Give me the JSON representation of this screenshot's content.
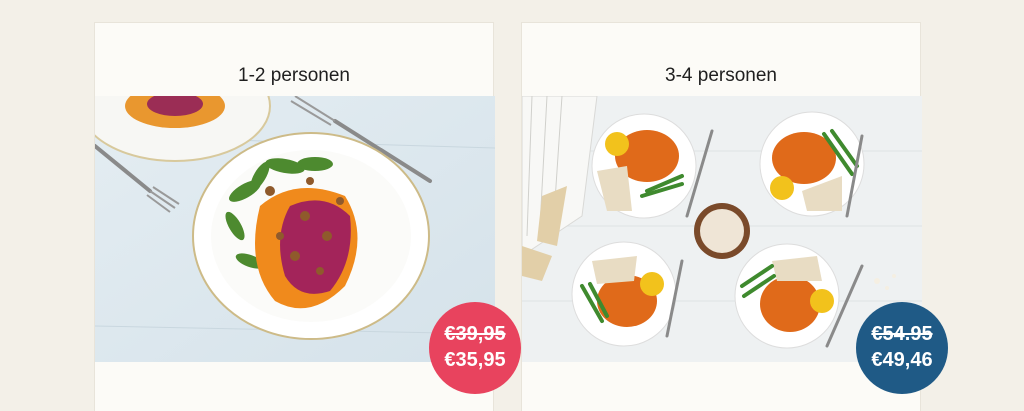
{
  "products": [
    {
      "title": "1-2 personen",
      "image_icon": "pumpkin-beet-mash-plate-photo",
      "old_price": "€39,95",
      "new_price": "€35,95",
      "badge_color": "#e8435e"
    },
    {
      "title": "3-4 personen",
      "image_icon": "curry-four-plates-photo",
      "old_price": "€54.95",
      "new_price": "€49,46",
      "badge_color": "#1f5a86"
    }
  ]
}
